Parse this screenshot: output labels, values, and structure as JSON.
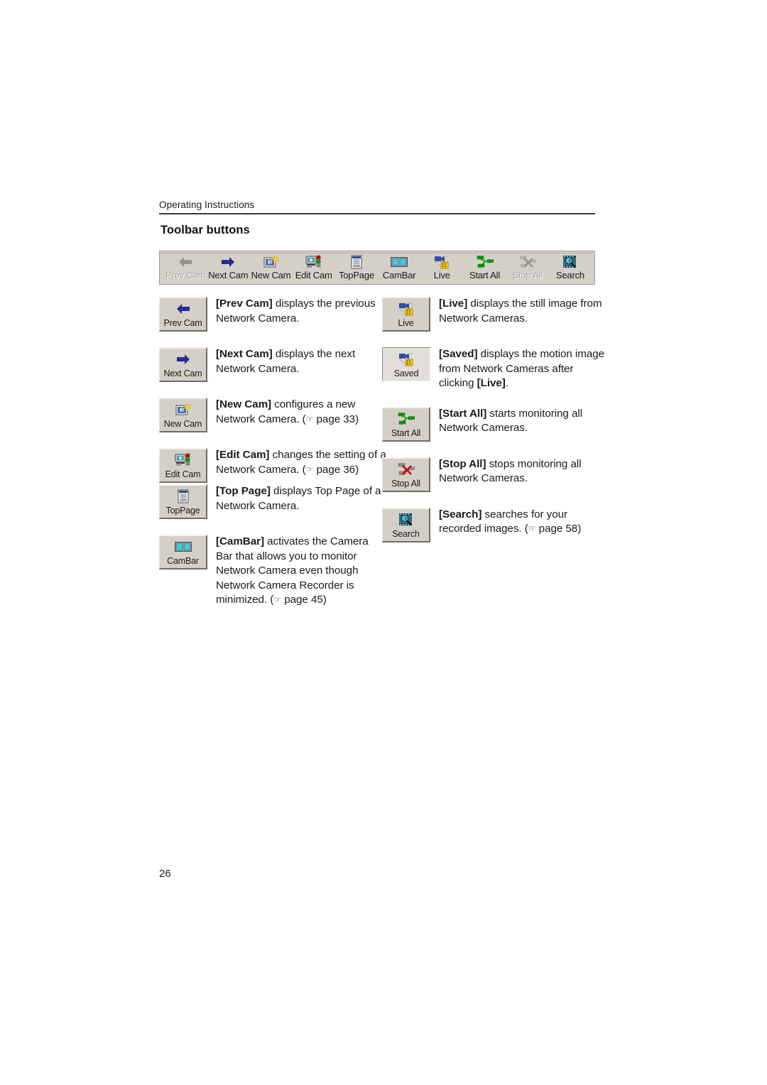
{
  "document": {
    "header": "Operating Instructions",
    "section_title": "Toolbar buttons",
    "page_number": "26"
  },
  "toolbar": {
    "items": [
      {
        "label": "Prev Cam",
        "icon": "arrow-left-icon",
        "disabled": true
      },
      {
        "label": "Next Cam",
        "icon": "arrow-right-icon",
        "disabled": false
      },
      {
        "label": "New Cam",
        "icon": "new-camera-icon",
        "disabled": false
      },
      {
        "label": "Edit Cam",
        "icon": "edit-camera-icon",
        "disabled": false
      },
      {
        "label": "TopPage",
        "icon": "top-page-icon",
        "disabled": false
      },
      {
        "label": "CamBar",
        "icon": "cambar-icon",
        "disabled": false
      },
      {
        "label": "Live",
        "icon": "live-icon",
        "disabled": false
      },
      {
        "label": "Start All",
        "icon": "start-all-icon",
        "disabled": false
      },
      {
        "label": "Stop All",
        "icon": "stop-all-icon",
        "disabled": true
      },
      {
        "label": "Search",
        "icon": "search-icon",
        "disabled": false
      }
    ]
  },
  "left_column": [
    {
      "button_label": "Prev Cam",
      "icon": "arrow-left-icon",
      "pressed": false,
      "name": "[Prev Cam]",
      "text": " displays the previous Network Camera.",
      "reference": ""
    },
    {
      "button_label": "Next Cam",
      "icon": "arrow-right-icon",
      "pressed": false,
      "name": "[Next Cam]",
      "text": " displays the next Network Camera.",
      "reference": ""
    },
    {
      "button_label": "New Cam",
      "icon": "new-camera-icon",
      "pressed": false,
      "name": "[New Cam]",
      "text": " configures a new Network Camera. (",
      "reference": "page 33)"
    },
    {
      "button_label": "Edit Cam",
      "icon": "edit-camera-icon",
      "pressed": false,
      "name": "[Edit Cam]",
      "text": " changes the setting of a Network Camera. (",
      "reference": "page 36)"
    },
    {
      "button_label": "TopPage",
      "icon": "top-page-icon",
      "pressed": false,
      "name": "[Top Page]",
      "text": " displays Top Page of a Network Camera.",
      "reference": ""
    },
    {
      "button_label": "CamBar",
      "icon": "cambar-icon",
      "pressed": false,
      "name": "[CamBar]",
      "text": " activates the Camera Bar that allows you to monitor Network Camera even though Network Camera Recorder is minimized. (",
      "reference": "page 45)"
    }
  ],
  "right_column": [
    {
      "button_label": "Live",
      "icon": "live-icon",
      "pressed": false,
      "name": "[Live]",
      "text": " displays the still image from Network Cameras.",
      "reference": ""
    },
    {
      "button_label": "Saved",
      "icon": "live-icon",
      "pressed": true,
      "name": "[Saved]",
      "text": " displays the motion image from Network Cameras after clicking ",
      "emphasis": "[Live]",
      "text_tail": ".",
      "reference": ""
    },
    {
      "button_label": "Start All",
      "icon": "start-all-icon",
      "pressed": false,
      "name": "[Start All]",
      "text": " starts monitoring all Network Cameras.",
      "reference": ""
    },
    {
      "button_label": "Stop All",
      "icon": "stop-all-icon",
      "pressed": false,
      "name": "[Stop All]",
      "text": " stops monitoring all Network Cameras.",
      "reference": ""
    },
    {
      "button_label": "Search",
      "icon": "search-icon",
      "pressed": false,
      "name": "[Search]",
      "text": " searches for your recorded images. (",
      "reference": "page 58)"
    }
  ],
  "colors": {
    "button_face": "#d4d0c8",
    "blue_arrow": "#1f2f9e",
    "gray_arrow": "#9e9e9e",
    "green": "#00a000",
    "red": "#d00000",
    "yellow": "#ffd21e",
    "teal": "#2e8fa0"
  },
  "glyphs": {
    "pointing_hand": "☞"
  }
}
